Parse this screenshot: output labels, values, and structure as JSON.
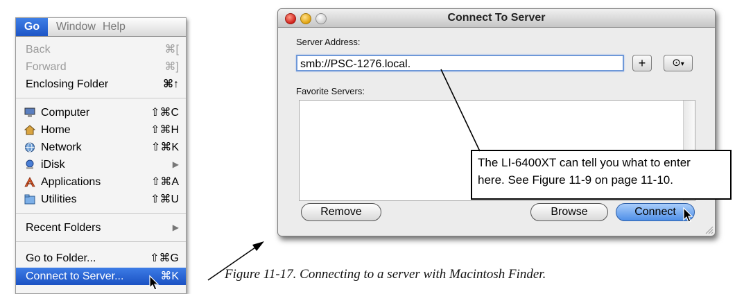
{
  "menubar": {
    "items": [
      "Go",
      "Window",
      "Help"
    ]
  },
  "menu": {
    "items": [
      {
        "label": "Back",
        "shortcut": "⌘[",
        "disabled": true
      },
      {
        "label": "Forward",
        "shortcut": "⌘]",
        "disabled": true
      },
      {
        "label": "Enclosing Folder",
        "shortcut": "⌘↑"
      },
      {
        "label": "Computer",
        "shortcut": "⇧⌘C",
        "icon": "computer-icon"
      },
      {
        "label": "Home",
        "shortcut": "⇧⌘H",
        "icon": "home-icon"
      },
      {
        "label": "Network",
        "shortcut": "⇧⌘K",
        "icon": "network-icon"
      },
      {
        "label": "iDisk",
        "shortcut": "▶",
        "icon": "idisk-icon"
      },
      {
        "label": "Applications",
        "shortcut": "⇧⌘A",
        "icon": "applications-icon"
      },
      {
        "label": "Utilities",
        "shortcut": "⇧⌘U",
        "icon": "utilities-icon"
      },
      {
        "label": "Recent Folders",
        "shortcut": "▶"
      },
      {
        "label": "Go to Folder...",
        "shortcut": "⇧⌘G"
      },
      {
        "label": "Connect to Server...",
        "shortcut": "⌘K",
        "selected": true
      }
    ]
  },
  "dialog": {
    "title": "Connect To Server",
    "server_address_label": "Server Address:",
    "server_address_value": "smb://PSC-1276.local.",
    "add_button": "+",
    "history_button": "⊙",
    "favorite_servers_label": "Favorite Servers:",
    "remove_button": "Remove",
    "browse_button": "Browse",
    "connect_button": "Connect"
  },
  "callout": {
    "line1": "The LI-6400XT can tell you what to enter",
    "line2": "here. See Figure 11-9 on page 11-10."
  },
  "caption": "Figure 11-17. Connecting to a server with Macintosh Finder.",
  "colors": {
    "selection": "#1d55c6",
    "default_button": "#4f8fe8"
  }
}
